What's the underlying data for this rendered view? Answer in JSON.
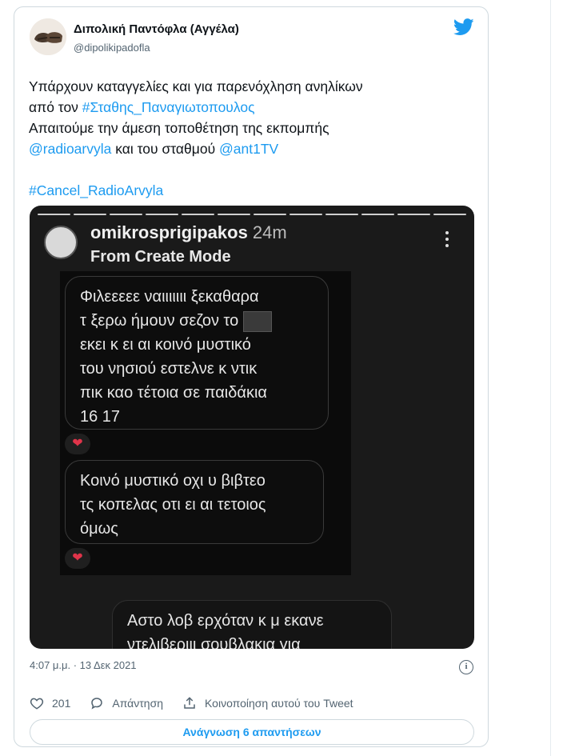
{
  "tweet": {
    "display_name": "Διπολική Παντόφλα (Αγγέλα)",
    "handle": "@dipolikipadofla",
    "text": {
      "line1": "Υπάρχουν καταγγελίες και για παρενόχληση ανηλίκων",
      "line2_prefix": "από τον ",
      "hashtag1": "#Σταθης_Παναγιωτοπουλος",
      "line3": "Απαιτούμε την άμεση τοποθέτηση της εκπομπής",
      "mention1": "@radioarvyla",
      "line4_mid": " και του σταθμού ",
      "mention2": "@ant1TV",
      "hashtag2": "#Cancel_RadioArvyla"
    },
    "timestamp": "4:07 μ.μ. · 13 Δεκ 2021",
    "likes": "201",
    "reply_label": "Απάντηση",
    "share_label": "Κοινοποίηση αυτού του Tweet",
    "read_replies": "Ανάγνωση 6 απαντήσεων"
  },
  "story": {
    "username": "omikrosprigipakos",
    "time": "24m",
    "subtitle": "From Create Mode",
    "message1": {
      "l1": "Φιλεεεεε ναιιιιιιι ξεκαθαρα",
      "l2": "τ ξερω ήμουν σεζον το",
      "l3": "εκει κ ει αι κοινό μυστικό",
      "l4": "του νησιού εστελνε κ ντικ",
      "l5": "πικ καο τέτοια σε παιδάκια",
      "l6": "16 17"
    },
    "message2": {
      "l1": "Κοινό μυστικό οχι υ βιβτεο",
      "l2": "τς κοπελας οτι ει αι τετοιος",
      "l3": "όμως"
    },
    "message3": {
      "l1": "Αστο λοβ ερχόταν κ μ εκανε",
      "l2": "ντελιβεριιι σουβλακια για"
    },
    "reaction": "❤"
  },
  "icons": [
    "twitter-bird-icon",
    "heart-icon",
    "reply-icon",
    "share-icon",
    "info-icon",
    "more-dots-icon"
  ],
  "colors": {
    "link": "#1d9bf0",
    "muted": "#536471",
    "border": "#cfd9de",
    "story_bg": "#1a1a1a"
  }
}
